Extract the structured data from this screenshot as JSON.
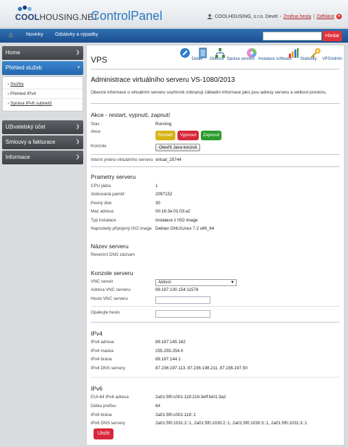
{
  "header": {
    "logo_main": "COOL",
    "logo_rest": "HOUSING.NET",
    "app_title": "ControlPanel",
    "user_text": "COOLHOUSING, s.r.o. Devel",
    "change_password": "Změna hesla",
    "separator": "|",
    "logout": "Odhlásit",
    "colors": {
      "brand_blue": "#2a78be",
      "logout_red": "#d33"
    }
  },
  "nav": {
    "items": [
      "Novinky",
      "Odstávky a výpadky"
    ],
    "search_placeholder": "",
    "search_button": "Hledat"
  },
  "sidebar": {
    "home": "Home",
    "services": "Přehled služeb",
    "sub_items": [
      "Služby",
      "Přehled IPv4",
      "Správa IPv6 subnetů"
    ],
    "account": "Uživatelský účet",
    "contracts": "Smlouvy a fakturace",
    "info": "Informace"
  },
  "main": {
    "page_title": "VPS",
    "toolbar": [
      "Detail",
      "Obecné",
      "Správa serveru",
      "Instalace software",
      "Statistiky",
      "VPSAdmin"
    ],
    "heading": "Administrace virtuálního serveru VS-1080/2013",
    "lead": "Obecné informace o virtuálním serveru souhrnně zobrazují základní informace jako jsou adresy serveru a velikost prostoru.",
    "actions": {
      "title": "Akce - restart, vypnutí, zapnutí",
      "state_label": "Stav",
      "state_value": "Running",
      "action_label": "Akce",
      "restart": "Restart",
      "stop": "Vypnout",
      "start": "Zapnout",
      "console_label": "Konzole",
      "console_button": "Otevřít Java konzoli"
    },
    "internal_name_label": "Interní jméno virtuálního serveru",
    "internal_name_value": "virtual_25744",
    "params": {
      "title": "Prametry serveru",
      "rows": [
        {
          "label": "CPU jádra",
          "value": "1"
        },
        {
          "label": "Alokovaná paměť",
          "value": "2097152"
        },
        {
          "label": "Pevný disk",
          "value": "30"
        },
        {
          "label": "Mac adresa",
          "value": "00:16:3e:01:03:a2"
        },
        {
          "label": "Typ instalace",
          "value": "Instalace z ISO image"
        },
        {
          "label": "Naposledy připojený ISO image",
          "value": "Debian GNU/Linux 7.2 x86_64"
        }
      ]
    },
    "server_name": {
      "title": "Název serveru",
      "reverse_label": "Reverzní DNS záznam"
    },
    "console": {
      "title": "Konzole serveru",
      "vnc_label": "VNC server",
      "vnc_value": "Aktivní",
      "vnc_addr_label": "Adresa VNC serveru",
      "vnc_addr_value": "89.187.130.154:11578",
      "vnc_pass_label": "Heslo VNC serveru",
      "repeat_label": "Opakujte heslo"
    },
    "ipv4": {
      "title": "IPv4",
      "rows": [
        {
          "label": "IPv4 adresa",
          "value": "89.187.145.162"
        },
        {
          "label": "IPv4 maska",
          "value": "255.255.254.0"
        },
        {
          "label": "IPv4 brána",
          "value": "89.187.144.1"
        },
        {
          "label": "IPv4 DNS servery",
          "value": "87.236.197.113, 87.236.198.211, 87.236.197.50"
        }
      ]
    },
    "ipv6": {
      "title": "IPv6",
      "rows": [
        {
          "label": "EUI-64 IPv6 adresa",
          "value": "2a01:5f0:c001:119:216:3eff:fe01:3a2"
        },
        {
          "label": "Délka prefixu",
          "value": "64"
        },
        {
          "label": "IPv6 brána",
          "value": "2a01:5f0:c001:119::1"
        },
        {
          "label": "IPv6 DNS servery",
          "value": "2a01:5f0:1031:2::1, 2a01:5f0:1030:2::1, 2a01:5f0:1030:3::1, 2a01:5f0:1031:3::1"
        }
      ]
    },
    "save_button": "Uložit"
  }
}
